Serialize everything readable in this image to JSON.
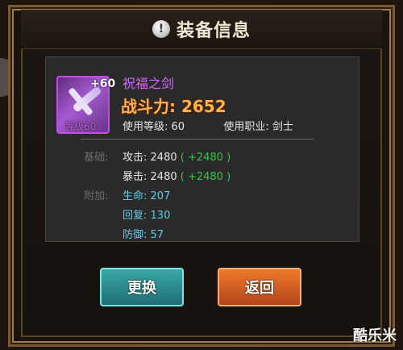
{
  "dialog": {
    "title": "装备信息",
    "title_icon": "exclamation-icon"
  },
  "item": {
    "name": "祝福之剑",
    "enhance": "+60",
    "level_tag": "等级60",
    "power_text": "战斗力: 2652",
    "use_level_label": "使用等级:",
    "use_level_value": "60",
    "use_class_label": "使用职业:",
    "use_class_value": "剑士"
  },
  "stats": {
    "base_label": "基础:",
    "base": [
      {
        "key": "攻击:",
        "value": "2480",
        "bonus": "( +2480 )"
      },
      {
        "key": "暴击:",
        "value": "2480",
        "bonus": "( +2480 )"
      }
    ],
    "extra_label": "附加:",
    "extra": [
      {
        "key": "生命:",
        "value": "207"
      },
      {
        "key": "回复:",
        "value": "130"
      },
      {
        "key": "防御:",
        "value": "57"
      }
    ]
  },
  "buttons": {
    "change": "更换",
    "back": "返回"
  },
  "watermark": "酷乐米",
  "colors": {
    "item_name": "#d864ff",
    "power": "#ffb34d",
    "bonus": "#39c24a",
    "extra_key": "#64c9e6",
    "btn_change": "#2a8f92",
    "btn_back": "#e0661f"
  }
}
